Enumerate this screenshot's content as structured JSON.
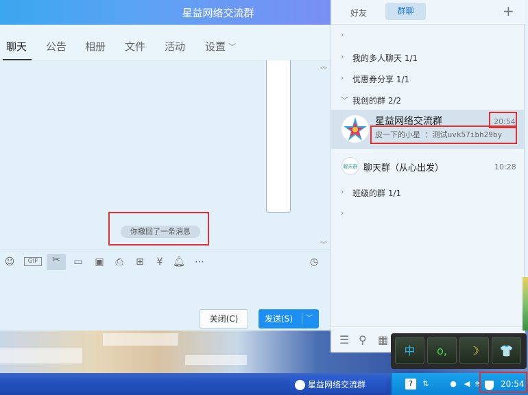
{
  "chat": {
    "title": "星益网络交流群",
    "tabs": [
      "聊天",
      "公告",
      "相册",
      "文件",
      "活动",
      "设置"
    ],
    "recall_notice": "你撤回了一条消息",
    "close_label": "关闭(C)",
    "send_label": "发送(S)",
    "toolbar_icons": [
      "emoji-icon",
      "gif-icon",
      "scissors-icon",
      "folder-icon",
      "image-icon",
      "screenshot-icon",
      "gift-icon",
      "red-packet-icon",
      "bell-icon",
      "more-icon",
      "history-icon"
    ]
  },
  "panel": {
    "tab_friends": "好友",
    "tab_groups": "群聊",
    "groups": [
      {
        "label": "我的多人聊天 1/1"
      },
      {
        "label": "优惠券分享 1/1"
      },
      {
        "label": "我创的群 2/2"
      },
      {
        "label": "班级的群 1/1"
      }
    ],
    "g1": {
      "name": "星益网络交流群",
      "time": "20:54",
      "preview": "皮一下的小星  ：测试uvk57ibh29by"
    },
    "g2": {
      "name": "聊天群（从心出发）",
      "time": "10:28",
      "avatar_text": "聊天群"
    }
  },
  "ime": [
    "中",
    "o,",
    "☽",
    "👕"
  ],
  "taskbar": {
    "window_label": "星益网络交流群",
    "clock": "20:54"
  },
  "colors": {
    "accent": "#1d8ef2",
    "highlight_box": "#e03030"
  }
}
